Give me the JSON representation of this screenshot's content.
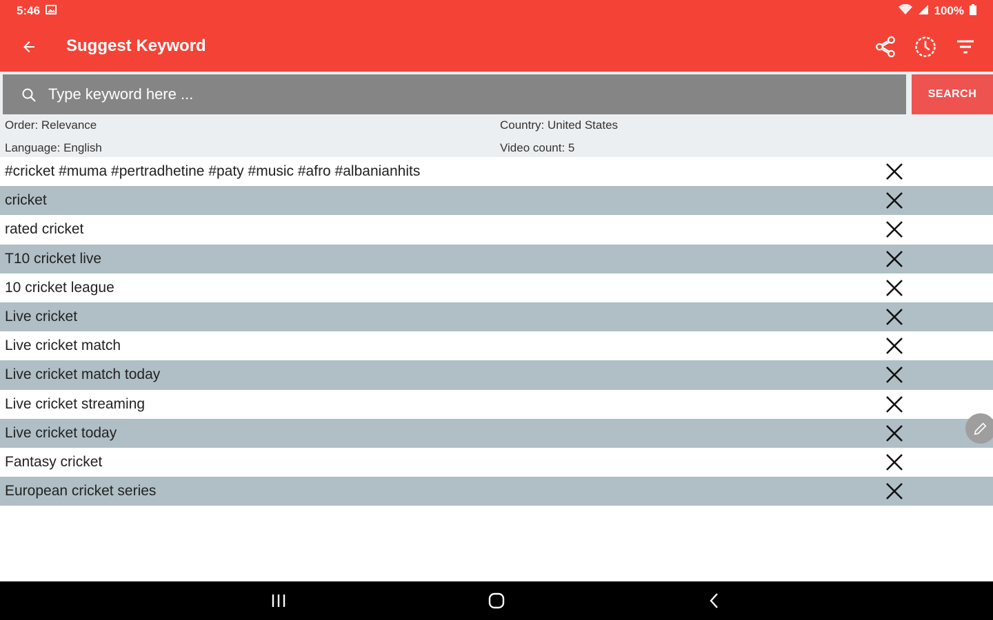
{
  "status": {
    "time": "5:46",
    "battery": "100%"
  },
  "toolbar": {
    "title": "Suggest Keyword"
  },
  "search": {
    "placeholder": "Type keyword here ...",
    "button_label": "SEARCH"
  },
  "meta": {
    "order": "Order: Relevance",
    "country": "Country: United States",
    "language": "Language: English",
    "video_count": "Video count: 5"
  },
  "keywords": [
    "#cricket #muma #pertradhetine #paty #music #afro #albanianhits",
    "cricket",
    "rated cricket",
    "T10 cricket live",
    "10 cricket league",
    "Live cricket",
    "Live cricket match",
    "Live cricket match today",
    "Live cricket streaming",
    "Live cricket today",
    "Fantasy cricket",
    "European cricket series"
  ],
  "colors": {
    "primary": "#f44336",
    "search_button": "#ef5350",
    "row_alt": "#b0bec5",
    "search_box": "#858585"
  },
  "icons": {
    "back": "arrow-back-icon",
    "share": "share-icon",
    "history": "history-icon",
    "filter": "filter-icon",
    "search": "search-icon",
    "delete": "close-icon",
    "fab": "pencil-icon"
  }
}
